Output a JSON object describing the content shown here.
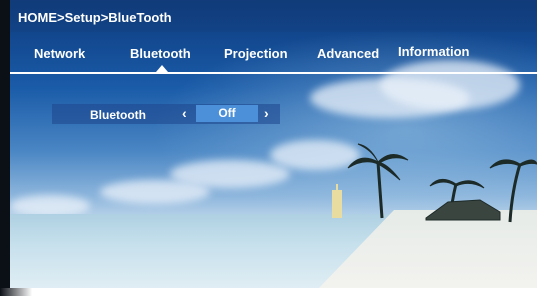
{
  "breadcrumb": "HOME>Setup>BlueTooth",
  "tabs": [
    {
      "label": "Network",
      "selected": false
    },
    {
      "label": "Bluetooth",
      "selected": true
    },
    {
      "label": "Projection",
      "selected": false
    },
    {
      "label": "Advanced",
      "selected": false
    },
    {
      "label": "Information",
      "selected": false
    }
  ],
  "setting": {
    "label": "Bluetooth",
    "prev_glyph": "‹",
    "value": "Off",
    "next_glyph": "›"
  },
  "colors": {
    "accent": "#4b90d8",
    "text": "#ffffff"
  },
  "icons": {
    "prev": "chevron-left-icon",
    "next": "chevron-right-icon",
    "tab_indicator": "caret-up-icon"
  }
}
